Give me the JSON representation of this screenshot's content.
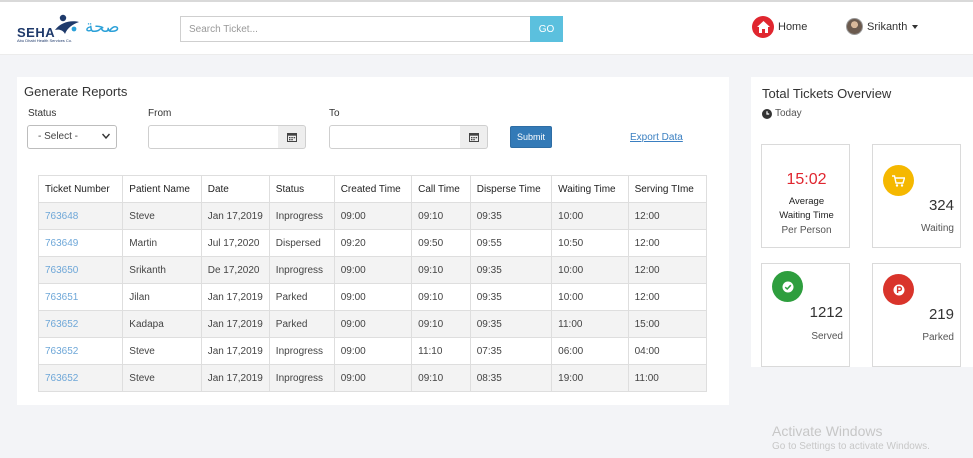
{
  "header": {
    "logo_text": "SEHA",
    "logo_subtext": "Abu Dhabi Health Services Co.",
    "logo_arabic": "صحة",
    "search_placeholder": "Search Ticket...",
    "go_label": "GO",
    "home_label": "Home",
    "user_name": "Srikanth"
  },
  "reports": {
    "title": "Generate Reports",
    "status_label": "Status",
    "status_selected": "- Select -",
    "from_label": "From",
    "to_label": "To",
    "submit_label": "Submit",
    "export_label": "Export Data",
    "columns": [
      "Ticket Number",
      "Patient Name",
      "Date",
      "Status",
      "Created Time",
      "Call Time",
      "Disperse Time",
      "Waiting Time",
      "Serving TIme"
    ],
    "rows": [
      [
        "763648",
        "Steve",
        "Jan 17,2019",
        "Inprogress",
        "09:00",
        "09:10",
        "09:35",
        "10:00",
        "12:00"
      ],
      [
        "763649",
        "Martin",
        "Jul 17,2020",
        "Dispersed",
        "09:20",
        "09:50",
        "09:55",
        "10:50",
        "12:00"
      ],
      [
        "763650",
        "Srikanth",
        "De 17,2020",
        "Inprogress",
        "09:00",
        "09:10",
        "09:35",
        "10:00",
        "12:00"
      ],
      [
        "763651",
        "Jilan",
        "Jan 17,2019",
        "Parked",
        "09:00",
        "09:10",
        "09:35",
        "10:00",
        "12:00"
      ],
      [
        "763652",
        "Kadapa",
        "Jan 17,2019",
        "Parked",
        "09:00",
        "09:10",
        "09:35",
        "11:00",
        "15:00"
      ],
      [
        "763652",
        "Steve",
        "Jan 17,2019",
        "Inprogress",
        "09:00",
        "11:10",
        "07:35",
        "06:00",
        "04:00"
      ],
      [
        "763652",
        "Steve",
        "Jan 17,2019",
        "Inprogress",
        "09:00",
        "09:10",
        "08:35",
        "19:00",
        "11:00"
      ]
    ]
  },
  "overview": {
    "title": "Total Tickets Overview",
    "period": "Today",
    "average": {
      "time": "15:02",
      "line1": "Average",
      "line2": "Waiting Time",
      "line3": "Per Person"
    },
    "waiting": {
      "value": "324",
      "label": "Waiting",
      "color": "#f5b800"
    },
    "served": {
      "value": "1212",
      "label": "Served",
      "color": "#2e9e3e"
    },
    "parked": {
      "value": "219",
      "label": "Parked",
      "color": "#d9342b"
    }
  },
  "watermark": {
    "line1": "Activate Windows",
    "line2": "Go to Settings to activate Windows."
  }
}
